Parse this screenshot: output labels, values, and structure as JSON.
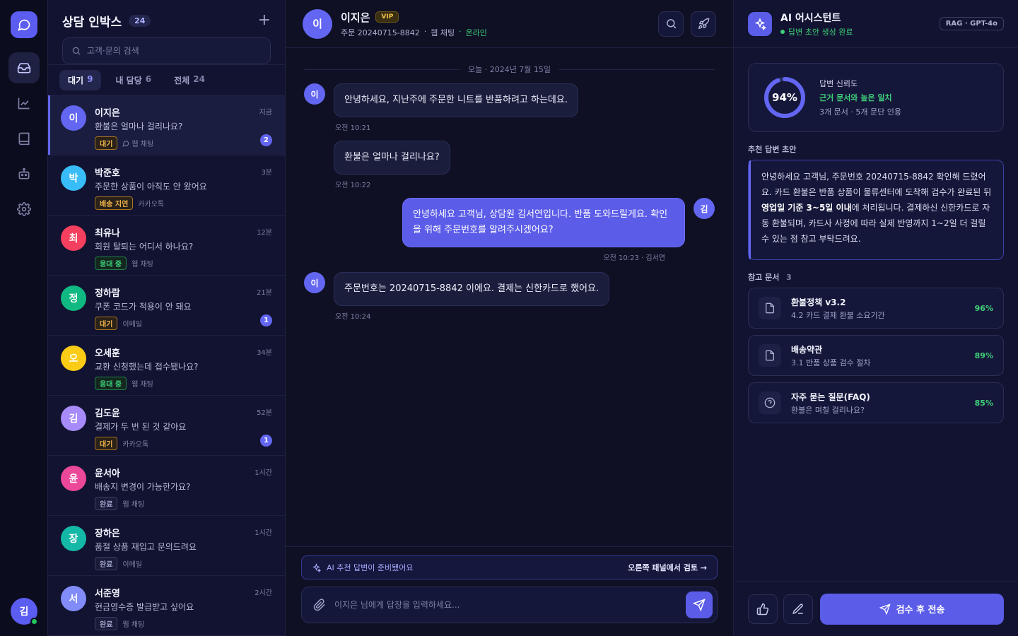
{
  "rail": {
    "avatar_initial": "김"
  },
  "inbox": {
    "title": "상담 인박스",
    "count": "24",
    "search_placeholder": "고객·문의 검색",
    "tabs": [
      {
        "label": "대기",
        "count": "9"
      },
      {
        "label": "내 담당",
        "count": "6"
      },
      {
        "label": "전체",
        "count": "24"
      }
    ],
    "conversations": [
      {
        "initial": "이",
        "name": "이지은",
        "message": "환불은 얼마나 걸리나요?",
        "status": "대기",
        "channel": "웹 채팅",
        "time": "지금",
        "unread": "2",
        "color": "#6366f1"
      },
      {
        "initial": "박",
        "name": "박준호",
        "message": "주문한 상품이 아직도 안 왔어요",
        "status": "배송 지연",
        "channel": "카카오톡",
        "time": "3분",
        "unread": "",
        "color": "#38bdf8"
      },
      {
        "initial": "최",
        "name": "최유나",
        "message": "회원 탈퇴는 어디서 하나요?",
        "status": "응대 중",
        "channel": "웹 채팅",
        "time": "12분",
        "unread": "",
        "color": "#f43f5e"
      },
      {
        "initial": "정",
        "name": "정하람",
        "message": "쿠폰 코드가 적용이 안 돼요",
        "status": "대기",
        "channel": "이메일",
        "time": "21분",
        "unread": "1",
        "color": "#10b981"
      },
      {
        "initial": "오",
        "name": "오세훈",
        "message": "교환 신청했는데 접수됐나요?",
        "status": "응대 중",
        "channel": "웹 채팅",
        "time": "34분",
        "unread": "",
        "color": "#facc15"
      },
      {
        "initial": "김",
        "name": "김도윤",
        "message": "결제가 두 번 된 것 같아요",
        "status": "대기",
        "channel": "카카오톡",
        "time": "52분",
        "unread": "1",
        "color": "#a78bfa"
      },
      {
        "initial": "윤",
        "name": "윤서아",
        "message": "배송지 변경이 가능한가요?",
        "status": "완료",
        "channel": "웹 채팅",
        "time": "1시간",
        "unread": "",
        "color": "#ec4899"
      },
      {
        "initial": "장",
        "name": "장하은",
        "message": "품절 상품 재입고 문의드려요",
        "status": "완료",
        "channel": "이메일",
        "time": "1시간",
        "unread": "",
        "color": "#14b8a6"
      },
      {
        "initial": "서",
        "name": "서준영",
        "message": "현금영수증 발급받고 싶어요",
        "status": "완료",
        "channel": "웹 채팅",
        "time": "2시간",
        "unread": "",
        "color": "#818cf8"
      }
    ]
  },
  "chat": {
    "customer_initial": "이",
    "customer_name": "이지은",
    "vip_label": "VIP",
    "order_label": "주문 20240715-8842",
    "channel": "웹 채팅",
    "presence": "온라인",
    "date_separator": "오늘 · 2024년 7월 15일",
    "messages": [
      {
        "text": "안녕하세요, 지난주에 주문한 니트를 반품하려고 하는데요.",
        "time": "오전 10:21"
      },
      {
        "text": "환불은 얼마나 걸리나요?",
        "time": "오전 10:22"
      },
      {
        "text": "안녕하세요 고객님, 상담원 김서연입니다. 반품 도와드릴게요. 확인을 위해 주문번호를 알려주시겠어요?",
        "time": "오전 10:23 · 김서연",
        "agent_initial": "김"
      },
      {
        "text": "주문번호는 20240715-8842 이에요. 결제는 신한카드로 했어요.",
        "time": "오전 10:24"
      }
    ],
    "ai_banner": "AI 추천 답변이 준비됐어요",
    "ai_banner_action": "오른쪽 패널에서 검토 →",
    "composer_placeholder": "이지은 님에게 답장을 입력하세요..."
  },
  "ai": {
    "title": "AI 어시스턴트",
    "status": "답변 초안 생성 완료",
    "model": "RAG · GPT-4o",
    "confidence": {
      "value": 94,
      "label": "94%",
      "title": "답변 신뢰도",
      "level": "근거 문서와 높은 일치",
      "sources": "3개 문서 · 5개 문단 인용"
    },
    "draft_label": "추천 답변 초안",
    "draft_part1": "안녕하세요 고객님, 주문번호 20240715-8842 확인해 드렸어요. 카드 환불은 반품 상품이 물류센터에 도착해 검수가 완료된 뒤 ",
    "draft_bold": "영업일 기준 3~5일 이내",
    "draft_part2": "에 처리됩니다. 결제하신 신한카드로 자동 환불되며, 카드사 사정에 따라 실제 반영까지 1~2일 더 걸릴 수 있는 점 참고 부탁드려요.",
    "refs_label": "참고 문서",
    "refs_count": "3",
    "refs": [
      {
        "title": "환불정책 v3.2",
        "sub": "4.2 카드 결제 환불 소요기간",
        "score": "96%",
        "icon": "document-icon"
      },
      {
        "title": "배송약관",
        "sub": "3.1 반품 상품 검수 절차",
        "score": "89%",
        "icon": "document-icon"
      },
      {
        "title": "자주 묻는 질문(FAQ)",
        "sub": "환불은 며칠 걸리나요?",
        "score": "85%",
        "icon": "help-circle-icon"
      }
    ],
    "send_label": "검수 후 전송"
  }
}
